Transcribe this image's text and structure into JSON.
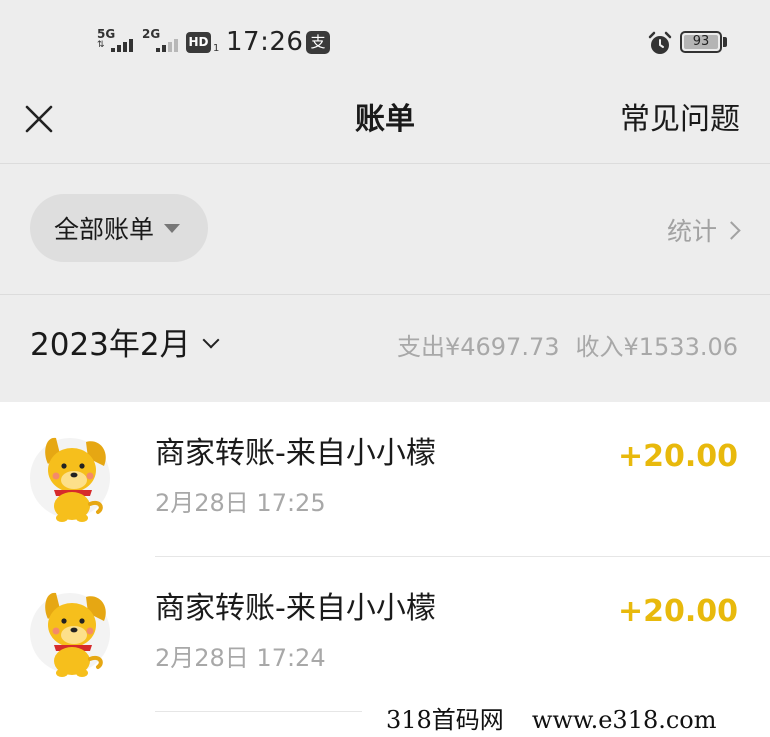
{
  "status_bar": {
    "sim1_network": "5G",
    "sim2_network": "2G",
    "hd_badge": "HD",
    "hd_sub": "1",
    "time": "17:26",
    "app_badge": "支",
    "battery": "93",
    "icons": [
      "signal-icon",
      "hd-icon",
      "alipay-icon",
      "alarm-icon",
      "battery-icon"
    ]
  },
  "nav": {
    "close_icon": "close-icon",
    "title": "账单",
    "faq_label": "常见问题"
  },
  "filter": {
    "all_bills_label": "全部账单",
    "stats_label": "统计"
  },
  "month": {
    "label": "2023年2月",
    "expense_label": "支出",
    "expense_value": "¥4697.73",
    "income_label": "收入",
    "income_value": "¥1533.06"
  },
  "transactions": [
    {
      "title": "商家转账-来自小小檬",
      "time": "2月28日 17:25",
      "amount": "+20.00",
      "avatar": "cartoon-dog-avatar"
    },
    {
      "title": "商家转账-来自小小檬",
      "time": "2月28日 17:24",
      "amount": "+20.00",
      "avatar": "cartoon-dog-avatar"
    }
  ],
  "watermark": {
    "left": "318首码网",
    "right": "www.e318.com"
  },
  "colors": {
    "background_gray": "#ededed",
    "amount_yellow": "#e8b90c",
    "secondary_text": "#a8a8a8"
  }
}
